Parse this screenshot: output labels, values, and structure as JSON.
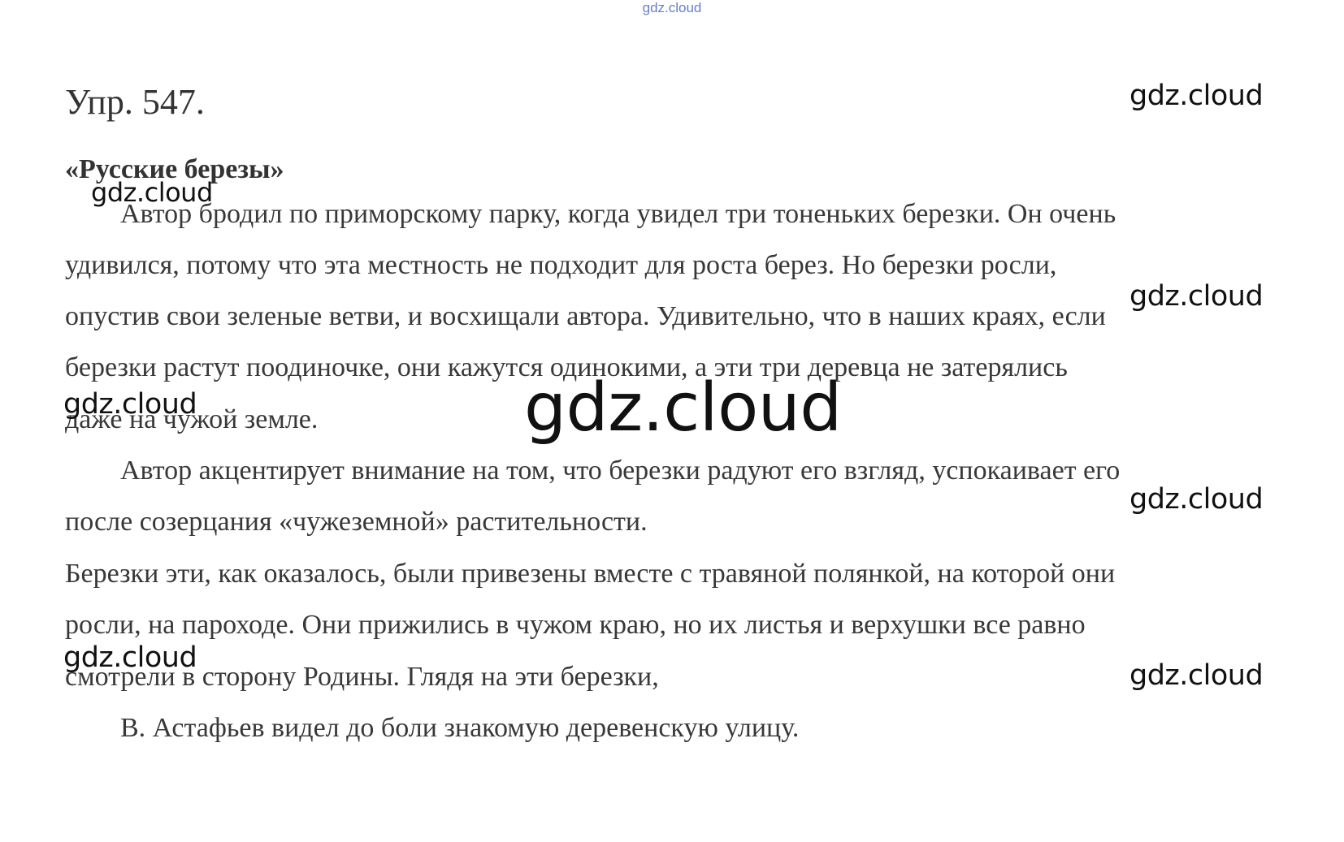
{
  "header": {
    "top_watermark": "gdz.cloud"
  },
  "exercise": {
    "title": "Упр. 547.",
    "story_title": "«Русские березы»",
    "lines": [
      "Автор бродил по приморскому парку, когда увидел три тоненьких березки. Он очень",
      "удивился, потому что эта местность не подходит для роста берез. Но березки росли,",
      "опустив свои зеленые ветви, и восхищали автора. Удивительно, что в наших краях, если",
      "березки растут поодиночке, они кажутся одинокими, а эти три деревца не затерялись",
      "даже на чужой земле.",
      "Автор акцентирует внимание на том, что березки радуют его взгляд, успокаивает его",
      "после созерцания «чужеземной» растительности.",
      "Березки эти, как оказалось, были привезены вместе с травяной полянкой, на которой они",
      "росли, на пароходе. Они прижились  в чужом краю, но их листья и верхушки все равно",
      "смотрели в сторону Родины. Глядя на эти березки,",
      "В. Астафьев видел до боли знакомую деревенскую улицу."
    ]
  },
  "watermarks": {
    "label": "gdz.cloud"
  }
}
